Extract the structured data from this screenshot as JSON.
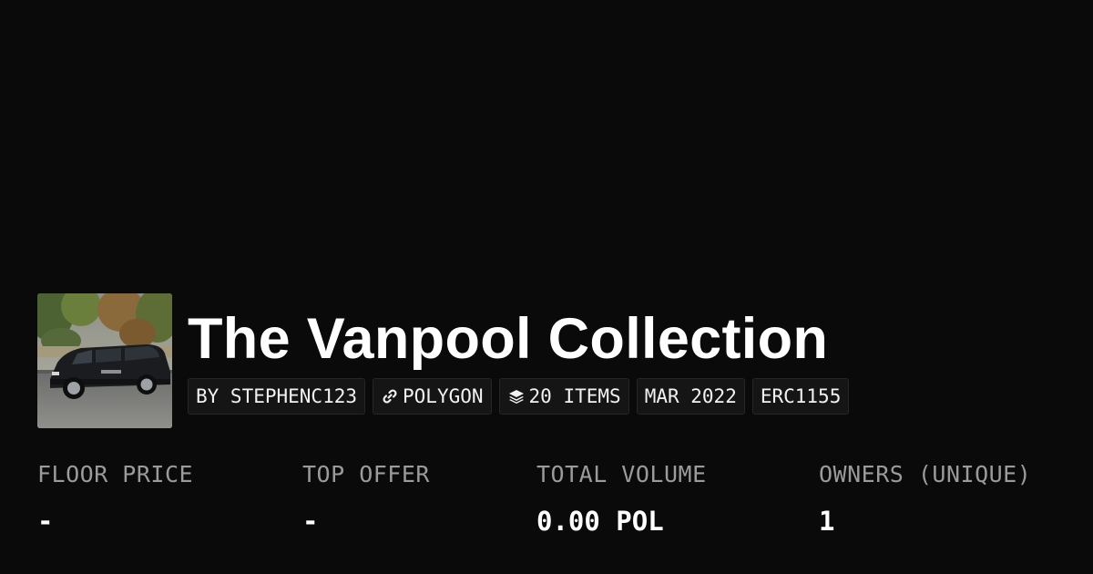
{
  "collection": {
    "title": "The Vanpool Collection",
    "image_alt": "Black minivan parked on a street",
    "chips": [
      {
        "label": "BY STEPHENC123",
        "icon": ""
      },
      {
        "label": "POLYGON",
        "icon": "link-icon"
      },
      {
        "label": "20 ITEMS",
        "icon": "layers-icon"
      },
      {
        "label": "MAR 2022",
        "icon": ""
      },
      {
        "label": "ERC1155",
        "icon": ""
      }
    ]
  },
  "stats": [
    {
      "label": "FLOOR PRICE",
      "value": "-"
    },
    {
      "label": "TOP OFFER",
      "value": "-"
    },
    {
      "label": "TOTAL VOLUME",
      "value": "0.00 POL"
    },
    {
      "label": "OWNERS (UNIQUE)",
      "value": "1"
    }
  ],
  "colors": {
    "background": "#0a0a0a",
    "text": "#ffffff",
    "muted": "#9b9b9b",
    "chip_bg": "#151515",
    "chip_border": "#262626"
  }
}
